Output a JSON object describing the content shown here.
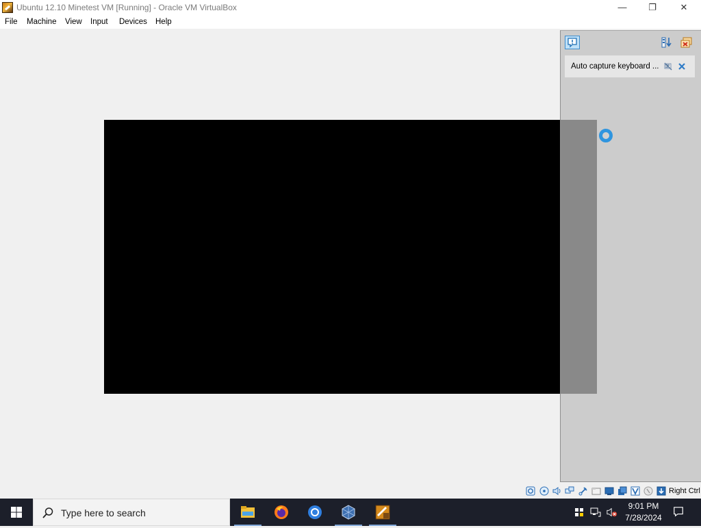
{
  "window": {
    "title": "Ubuntu 12.10 Minetest VM [Running] - Oracle VM VirtualBox",
    "minimize_glyph": "—",
    "maximize_glyph": "❐",
    "close_glyph": "✕"
  },
  "menu": {
    "items": [
      {
        "label": "File"
      },
      {
        "label": "Machine"
      },
      {
        "label": "View"
      },
      {
        "label": "Input"
      },
      {
        "label": "Devices"
      },
      {
        "label": "Help"
      }
    ]
  },
  "notification_panel": {
    "message": "Auto capture keyboard ...",
    "accent_color": "#2f95df"
  },
  "statusbar": {
    "host_key": "Right Ctrl",
    "indicators": [
      "hard-disk-icon",
      "optical-drive-icon",
      "audio-icon",
      "network-icon",
      "usb-icon",
      "shared-folders-icon",
      "display-icon",
      "video-capture-icon",
      "recording-icon",
      "mouse-integration-icon",
      "keyboard-capture-icon"
    ]
  },
  "taskbar": {
    "search_placeholder": "Type here to search",
    "apps": [
      {
        "name": "file-explorer-icon"
      },
      {
        "name": "firefox-icon"
      },
      {
        "name": "chrome-icon"
      },
      {
        "name": "virtualbox-manager-icon"
      },
      {
        "name": "virtualbox-vm-icon"
      }
    ],
    "clock": {
      "time": "9:01 PM",
      "date": "7/28/2024"
    }
  }
}
